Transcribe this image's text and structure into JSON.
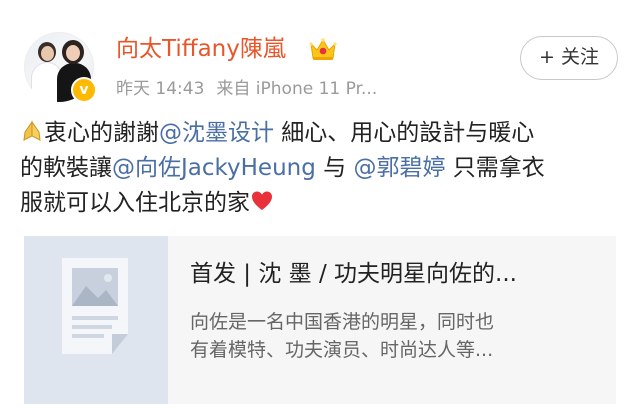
{
  "user": {
    "name": "向太Tiffany陳嵐",
    "verified_icon": "verified-badge",
    "membership_icon": "crown-icon",
    "avatar_icon": "avatar-photo"
  },
  "meta": {
    "time": "昨天 14:43",
    "source": "来自 iPhone 11 Pr..."
  },
  "follow_button": {
    "label": "+ 关注"
  },
  "post": {
    "emoji_start": "folded-hands-emoji",
    "line1_text": "衷心的謝謝",
    "mention1": "@沈墨设计",
    "line1_tail": " 細心、用心的設計与暖心",
    "line2_text": "的軟裝讓",
    "mention2": "@向佐JackyHeung",
    "line2_mid": " 与 ",
    "mention3": "@郭碧婷",
    "line2_tail": " 只需拿衣",
    "line3_text": "服就可以入住北京的家",
    "emoji_end": "red-heart-emoji"
  },
  "link_card": {
    "thumbnail_icon": "article-icon",
    "title": "首发 | 沈 墨 / 功夫明星向佐的...",
    "desc_line1": "向佐是一名中国香港的明星，同时也",
    "desc_line2": "有着模特、功夫演员、时尚达人等..."
  },
  "colors": {
    "username": "#e8562a",
    "mention": "#4a6fa5",
    "meta": "#9a9a9a",
    "badge": "#ffb900",
    "heart": "#e8313a",
    "card_bg": "#f6f6f6",
    "thumb_bg": "#dfe5ee"
  }
}
